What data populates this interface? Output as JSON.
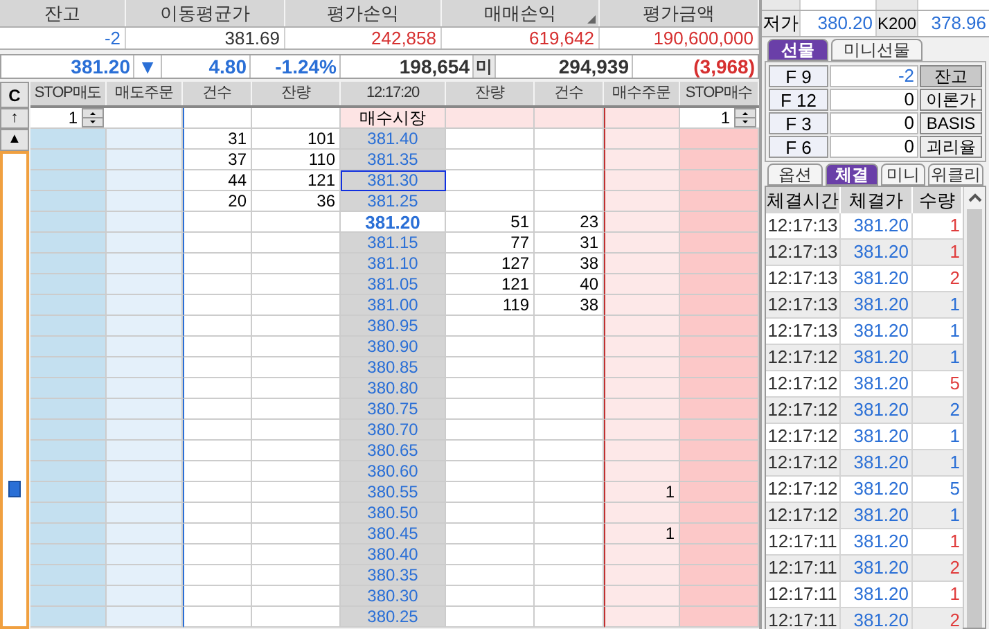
{
  "account": [
    {
      "label": "잔고",
      "value": "-2",
      "color": "#2a6fd6",
      "sort_mark": false
    },
    {
      "label": "이동평균가",
      "value": "381.69",
      "color": "#333333",
      "sort_mark": false
    },
    {
      "label": "평가손익",
      "value": "242,858",
      "color": "#d63030",
      "sort_mark": false
    },
    {
      "label": "매매손익",
      "value": "619,642",
      "color": "#d63030",
      "sort_mark": true
    },
    {
      "label": "평가금액",
      "value": "190,600,000",
      "color": "#d63030",
      "sort_mark": false
    }
  ],
  "quote": {
    "price": "381.20",
    "arrow": "▼",
    "change": "4.80",
    "rate": "-1.24%",
    "value_5": "198,654",
    "label_6": "미",
    "value_7": "294,939",
    "value_8": "(3,968)"
  },
  "ladder": {
    "controls": [
      "C",
      "↑",
      "▲"
    ],
    "columns": [
      "STOP매도",
      "매도주문",
      "건수",
      "잔량",
      "12:17:20",
      "잔량",
      "건수",
      "매수주문",
      "STOP매수"
    ],
    "stop_sell_qty": "1",
    "stop_buy_qty": "1",
    "market_buy": "매수시장",
    "rows": [
      {
        "sell_count": "31",
        "sell_qty": "101",
        "price": "381.40",
        "current": false,
        "selected": false
      },
      {
        "sell_count": "37",
        "sell_qty": "110",
        "price": "381.35",
        "current": false,
        "selected": false
      },
      {
        "sell_count": "44",
        "sell_qty": "121",
        "price": "381.30",
        "current": false,
        "selected": true
      },
      {
        "sell_count": "20",
        "sell_qty": "36",
        "price": "381.25",
        "current": false,
        "selected": false
      },
      {
        "price": "381.20",
        "buy_qty": "51",
        "buy_count": "23",
        "current": true,
        "selected": false
      },
      {
        "price": "381.15",
        "buy_qty": "77",
        "buy_count": "31",
        "current": false,
        "selected": false
      },
      {
        "price": "381.10",
        "buy_qty": "127",
        "buy_count": "38",
        "current": false,
        "selected": false
      },
      {
        "price": "381.05",
        "buy_qty": "121",
        "buy_count": "40",
        "current": false,
        "selected": false
      },
      {
        "price": "381.00",
        "buy_qty": "119",
        "buy_count": "38",
        "current": false,
        "selected": false
      },
      {
        "price": "380.95",
        "current": false,
        "selected": false
      },
      {
        "price": "380.90",
        "current": false,
        "selected": false
      },
      {
        "price": "380.85",
        "current": false,
        "selected": false
      },
      {
        "price": "380.80",
        "current": false,
        "selected": false
      },
      {
        "price": "380.75",
        "current": false,
        "selected": false
      },
      {
        "price": "380.70",
        "current": false,
        "selected": false
      },
      {
        "price": "380.65",
        "current": false,
        "selected": false
      },
      {
        "price": "380.60",
        "current": false,
        "selected": false
      },
      {
        "price": "380.55",
        "buy_order": "1",
        "current": false,
        "selected": false
      },
      {
        "price": "380.50",
        "current": false,
        "selected": false
      },
      {
        "price": "380.45",
        "buy_order": "1",
        "current": false,
        "selected": false
      },
      {
        "price": "380.40",
        "current": false,
        "selected": false
      },
      {
        "price": "380.35",
        "current": false,
        "selected": false
      },
      {
        "price": "380.30",
        "current": false,
        "selected": false
      },
      {
        "price": "380.25",
        "current": false,
        "selected": false
      }
    ]
  },
  "side_panel": {
    "info": [
      "저가",
      "380.20",
      "K200",
      "378.96"
    ],
    "tabs": [
      {
        "label": "선물",
        "selected": true
      },
      {
        "label": "미니선물",
        "selected": false
      }
    ],
    "contracts": [
      {
        "code": "F 9",
        "qty": "-2",
        "color": "#2a6fd6",
        "action": "잔고",
        "pressed": true
      },
      {
        "code": "F 12",
        "qty": "0",
        "color": "#000000",
        "action": "이론가",
        "pressed": false
      },
      {
        "code": "F 3",
        "qty": "0",
        "color": "#000000",
        "action": "BASIS",
        "pressed": false
      },
      {
        "code": "F 6",
        "qty": "0",
        "color": "#000000",
        "action": "괴리율",
        "pressed": false
      }
    ],
    "tabs_2": [
      {
        "label": "옵션",
        "selected": false
      },
      {
        "label": "체결",
        "selected": true
      },
      {
        "label": "미니",
        "selected": false
      },
      {
        "label": "위클리",
        "selected": false
      }
    ],
    "trades": {
      "columns": [
        "체결시간",
        "체결가",
        "수량"
      ],
      "rows": [
        {
          "time": "12:17:13",
          "price": "381.20",
          "qty": "1",
          "color": "#e03c3c"
        },
        {
          "time": "12:17:13",
          "price": "381.20",
          "qty": "1",
          "color": "#e03c3c"
        },
        {
          "time": "12:17:13",
          "price": "381.20",
          "qty": "2",
          "color": "#e03c3c"
        },
        {
          "time": "12:17:13",
          "price": "381.20",
          "qty": "1",
          "color": "#2a6fd6"
        },
        {
          "time": "12:17:13",
          "price": "381.20",
          "qty": "1",
          "color": "#2a6fd6"
        },
        {
          "time": "12:17:12",
          "price": "381.20",
          "qty": "1",
          "color": "#2a6fd6"
        },
        {
          "time": "12:17:12",
          "price": "381.20",
          "qty": "5",
          "color": "#e03c3c"
        },
        {
          "time": "12:17:12",
          "price": "381.20",
          "qty": "2",
          "color": "#2a6fd6"
        },
        {
          "time": "12:17:12",
          "price": "381.20",
          "qty": "1",
          "color": "#2a6fd6"
        },
        {
          "time": "12:17:12",
          "price": "381.20",
          "qty": "1",
          "color": "#2a6fd6"
        },
        {
          "time": "12:17:12",
          "price": "381.20",
          "qty": "5",
          "color": "#2a6fd6"
        },
        {
          "time": "12:17:12",
          "price": "381.20",
          "qty": "1",
          "color": "#2a6fd6"
        },
        {
          "time": "12:17:11",
          "price": "381.20",
          "qty": "1",
          "color": "#e03c3c"
        },
        {
          "time": "12:17:11",
          "price": "381.20",
          "qty": "2",
          "color": "#e03c3c"
        },
        {
          "time": "12:17:11",
          "price": "381.20",
          "qty": "1",
          "color": "#e03c3c"
        },
        {
          "time": "12:17:11",
          "price": "381.20",
          "qty": "2",
          "color": "#e03c3c"
        }
      ]
    }
  }
}
